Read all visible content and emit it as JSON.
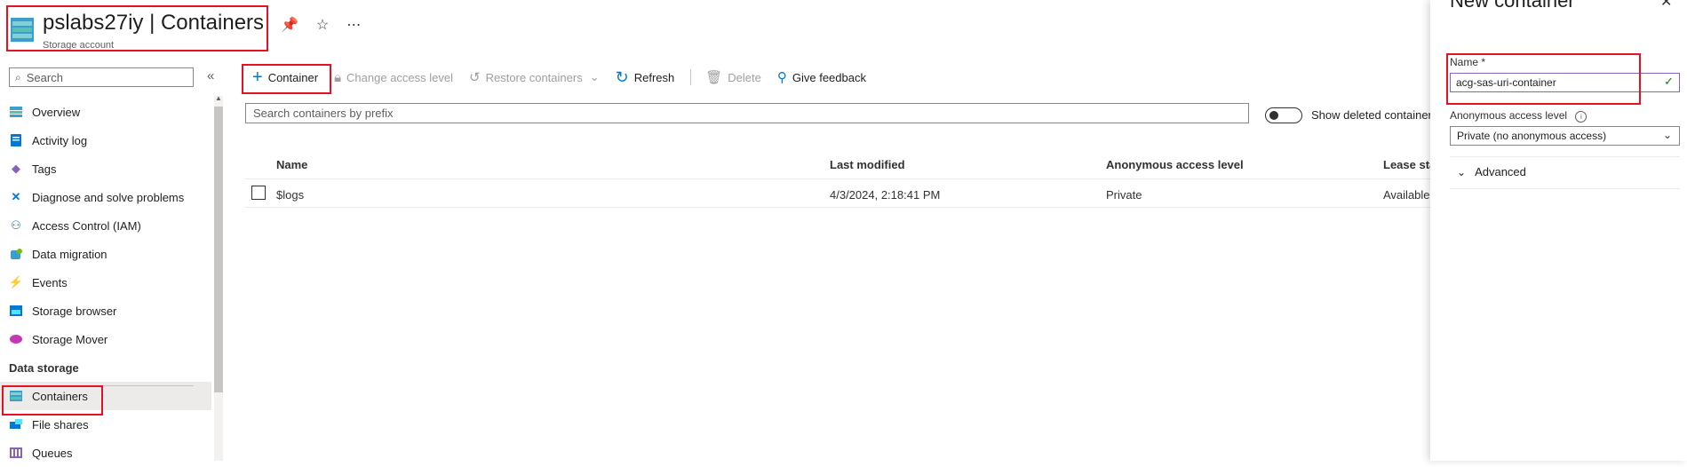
{
  "header": {
    "title": "pslabs27iy | Containers",
    "subtitle": "Storage account",
    "icons": [
      "storage-account-icon",
      "pin-icon",
      "star-icon",
      "more-icon"
    ]
  },
  "sidebar": {
    "search_placeholder": "Search",
    "collapse_label": "«",
    "items": [
      {
        "label": "Overview",
        "icon": "overview-icon"
      },
      {
        "label": "Activity log",
        "icon": "activity-log-icon"
      },
      {
        "label": "Tags",
        "icon": "tag-icon"
      },
      {
        "label": "Diagnose and solve problems",
        "icon": "wrench-icon"
      },
      {
        "label": "Access Control (IAM)",
        "icon": "people-icon"
      },
      {
        "label": "Data migration",
        "icon": "data-migration-icon"
      },
      {
        "label": "Events",
        "icon": "lightning-icon"
      },
      {
        "label": "Storage browser",
        "icon": "folder-icon"
      },
      {
        "label": "Storage Mover",
        "icon": "cloud-mover-icon"
      }
    ],
    "section_header": "Data storage",
    "section_items": [
      {
        "label": "Containers",
        "icon": "containers-icon",
        "selected": true
      },
      {
        "label": "File shares",
        "icon": "file-shares-icon"
      },
      {
        "label": "Queues",
        "icon": "queues-icon"
      }
    ]
  },
  "toolbar": {
    "container_label": "Container",
    "change_access_label": "Change access level",
    "restore_label": "Restore containers",
    "refresh_label": "Refresh",
    "delete_label": "Delete",
    "feedback_label": "Give feedback"
  },
  "filter": {
    "search_placeholder": "Search containers by prefix",
    "show_deleted_label": "Show deleted containers"
  },
  "table": {
    "columns": [
      "Name",
      "Last modified",
      "Anonymous access level",
      "Lease state"
    ],
    "rows": [
      {
        "name": "$logs",
        "last_modified": "4/3/2024, 2:18:41 PM",
        "access": "Private",
        "lease": "Available"
      }
    ]
  },
  "panel": {
    "title": "New container",
    "name_label": "Name *",
    "name_value": "acg-sas-uri-container",
    "access_label": "Anonymous access level",
    "access_value": "Private (no anonymous access)",
    "advanced_label": "Advanced"
  },
  "colors": {
    "accent": "#0078d4",
    "highlight_box": "#e81123",
    "valid_check": "#107c10"
  }
}
